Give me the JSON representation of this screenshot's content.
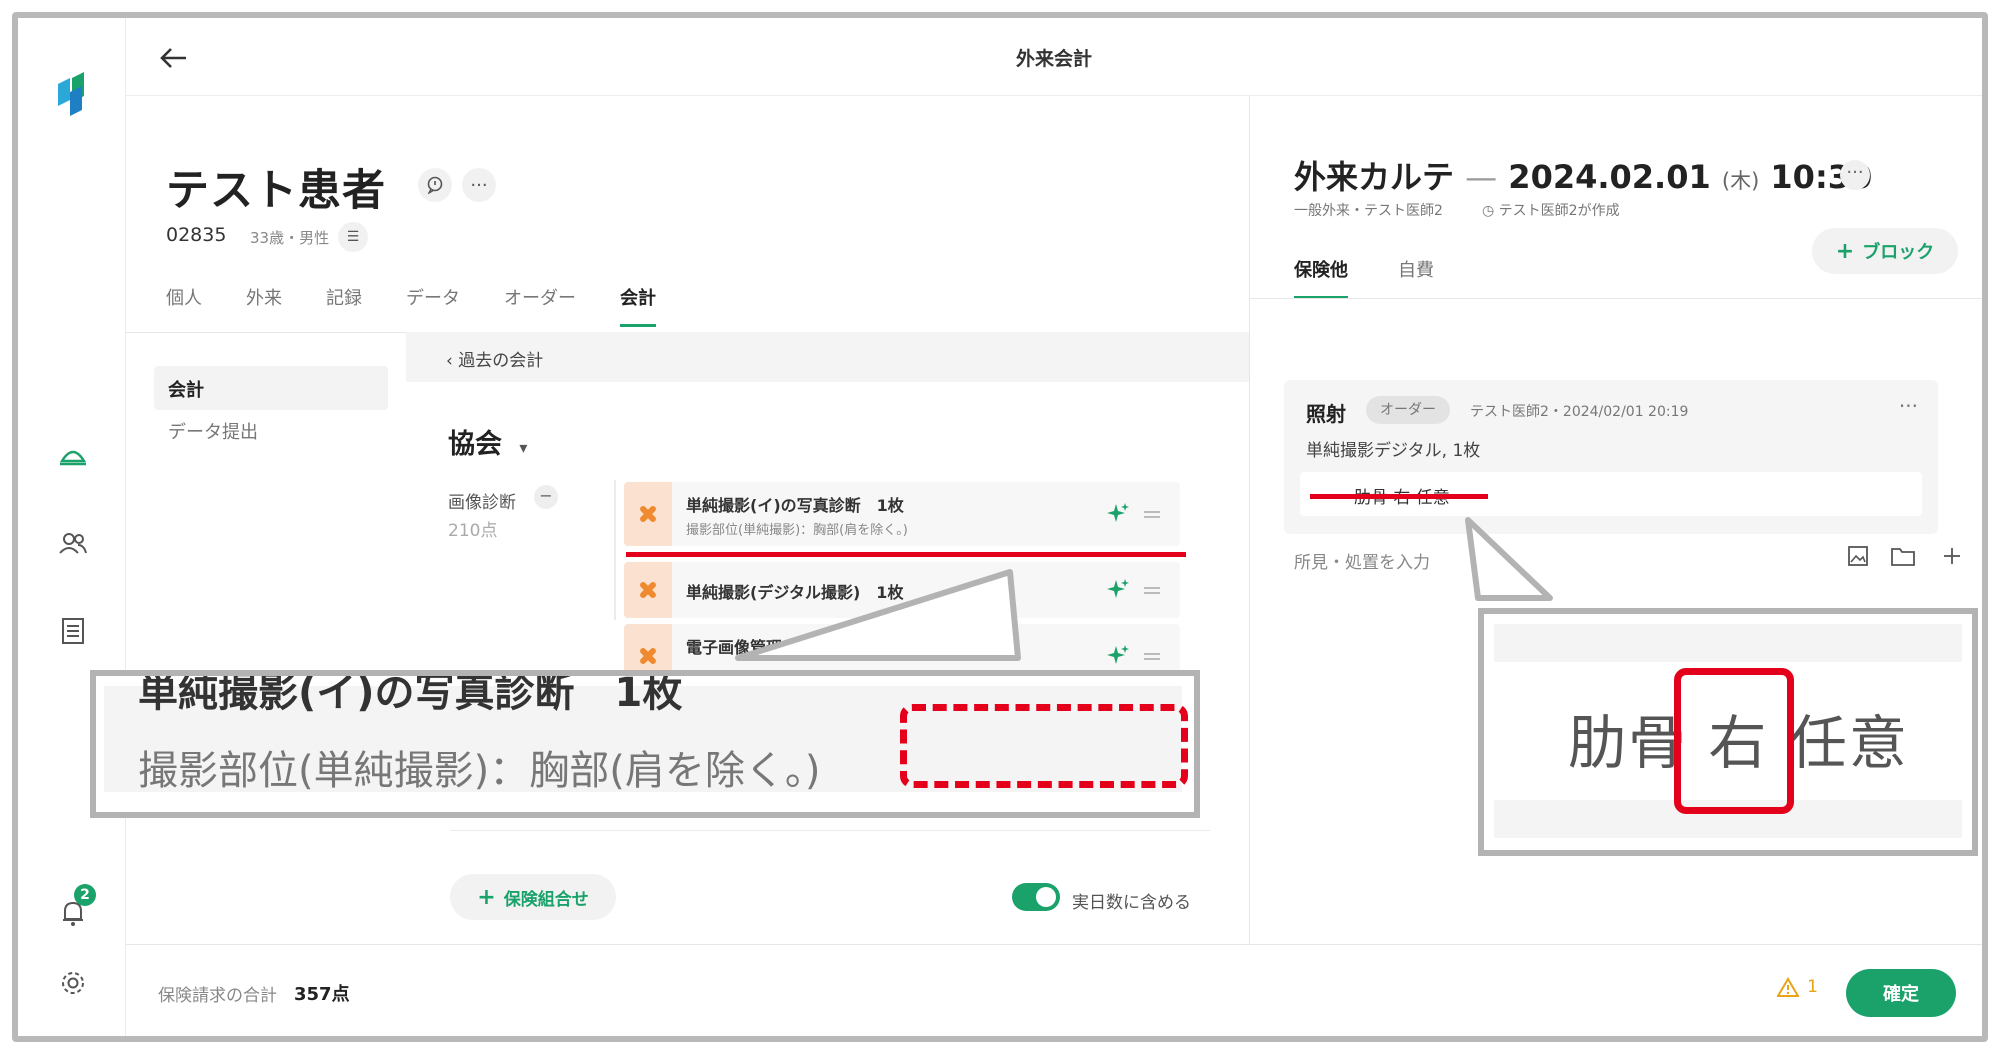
{
  "topbar": {
    "title": "外来会計"
  },
  "sidebar": {
    "notifications_count": "2"
  },
  "patient": {
    "name": "テスト患者",
    "id": "02835",
    "age_sex": "33歳・男性"
  },
  "tabs": [
    {
      "label": "個人"
    },
    {
      "label": "外来"
    },
    {
      "label": "記録"
    },
    {
      "label": "データ"
    },
    {
      "label": "オーダー"
    },
    {
      "label": "会計"
    }
  ],
  "subnav": [
    {
      "label": "会計"
    },
    {
      "label": "データ提出"
    }
  ],
  "billing": {
    "past_link": "過去の会計",
    "insurer": "協会",
    "category": {
      "label": "画像診断",
      "points": "210点",
      "toggle": "−"
    },
    "items": [
      {
        "title": "単純撮影(イ)の写真診断　1枚",
        "sub": "撮影部位(単純撮影)：胸部(肩を除く。)"
      },
      {
        "title": "単純撮影(デジタル撮影)　1枚",
        "sub": ""
      },
      {
        "title": "電子画像管理",
        "sub": ""
      }
    ],
    "add_combination": "保険組合せ",
    "toggle_label": "実日数に含める"
  },
  "callout_left": {
    "cut_text": "単純撮影(イ)の写真診断　1枚",
    "text": "撮影部位(単純撮影)：胸部(肩を除く。)"
  },
  "karte": {
    "title": "外来カルテ",
    "dash": "—",
    "date": "2024.02.01",
    "dow": "(木)",
    "time": "10:30",
    "meta": "一般外来・テスト医師2",
    "created_by": "テスト医師2が作成",
    "tabs": [
      {
        "label": "保険他"
      },
      {
        "label": "自費"
      }
    ],
    "add_block": "ブロック",
    "order": {
      "title": "照射",
      "chip": "オーダー",
      "meta": "テスト医師2・2024/02/01 20:19",
      "desc": "単純撮影デジタル, 1枚",
      "field_text": "肋骨 右 任意"
    },
    "memo_placeholder": "所見・処置を入力"
  },
  "callout_right": {
    "text": "肋骨 右 任意"
  },
  "footer": {
    "label": "保険請求の合計",
    "value": "357点",
    "warn_count": "1",
    "confirm": "確定"
  },
  "colors": {
    "accent": "#1ba26b",
    "highlight": "#e4001a",
    "warning": "#e8a317"
  }
}
